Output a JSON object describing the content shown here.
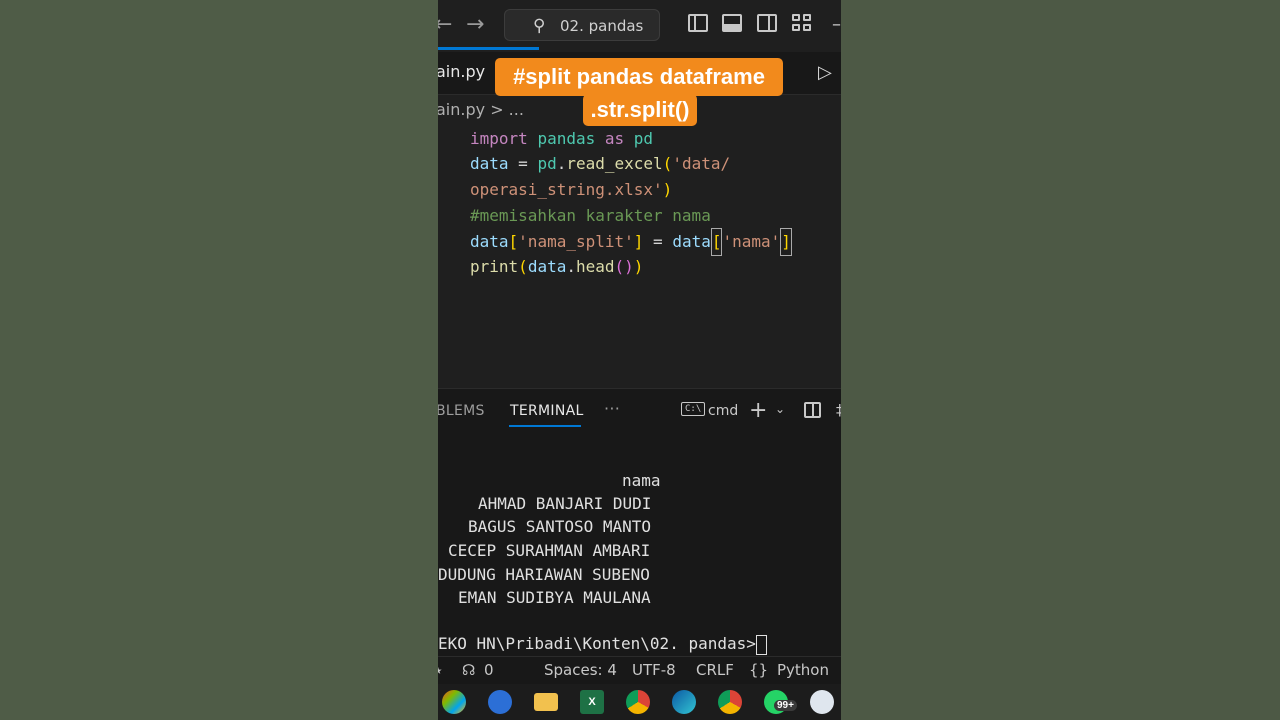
{
  "window": {
    "search_text": "02. pandas"
  },
  "editor": {
    "tab_label": "ain.py",
    "breadcrumb": "ain.py > ..."
  },
  "caption": {
    "line1": "#split pandas dataframe",
    "line2": ".str.split()"
  },
  "code": {
    "line1": {
      "kw1": "import",
      "mod1": "pandas",
      "kw2": "as",
      "mod2": "pd"
    },
    "line2": {
      "var": "data",
      "op": " = ",
      "obj": "pd",
      "dot": ".",
      "fn": "read_excel",
      "open": "(",
      "str": "'data/"
    },
    "line3": {
      "str": "operasi_string.xlsx'",
      "close": ")"
    },
    "line4": {
      "comment": "#memisahkan karakter nama"
    },
    "line5": {
      "var1": "data",
      "open1": "[",
      "str1": "'nama_split'",
      "close1": "]",
      "op": " = ",
      "var2": "data",
      "open2": "[",
      "str2": "'nama'",
      "close2": "]"
    },
    "line6": {
      "fn": "print",
      "open": "(",
      "var": "data",
      "dot": ".",
      "method": "head",
      "parens": "()",
      "close": ")"
    }
  },
  "panel": {
    "tabs": [
      "BLEMS",
      "TERMINAL"
    ],
    "more": "···",
    "shell_label": "cmd"
  },
  "terminal": {
    "header": "nama",
    "rows": [
      "AHMAD BANJARI DUDI",
      "BAGUS SANTOSO MANTO",
      "CECEP SURAHMAN AMBARI",
      "DUDUNG HARIAWAN SUBENO",
      "EMAN SUDIBYA MAULANA"
    ],
    "prompt": "EKO HN\\Pribadi\\Konten\\02. pandas>"
  },
  "status": {
    "ports": "0",
    "spaces": "Spaces: 4",
    "encoding": "UTF-8",
    "eol": "CRLF",
    "language": "Python"
  },
  "taskbar": {
    "badge": "99+"
  },
  "colors": {
    "caption_bg": "#f28a1c",
    "accent": "#0078d4",
    "editor_bg": "#1f1f1f"
  }
}
